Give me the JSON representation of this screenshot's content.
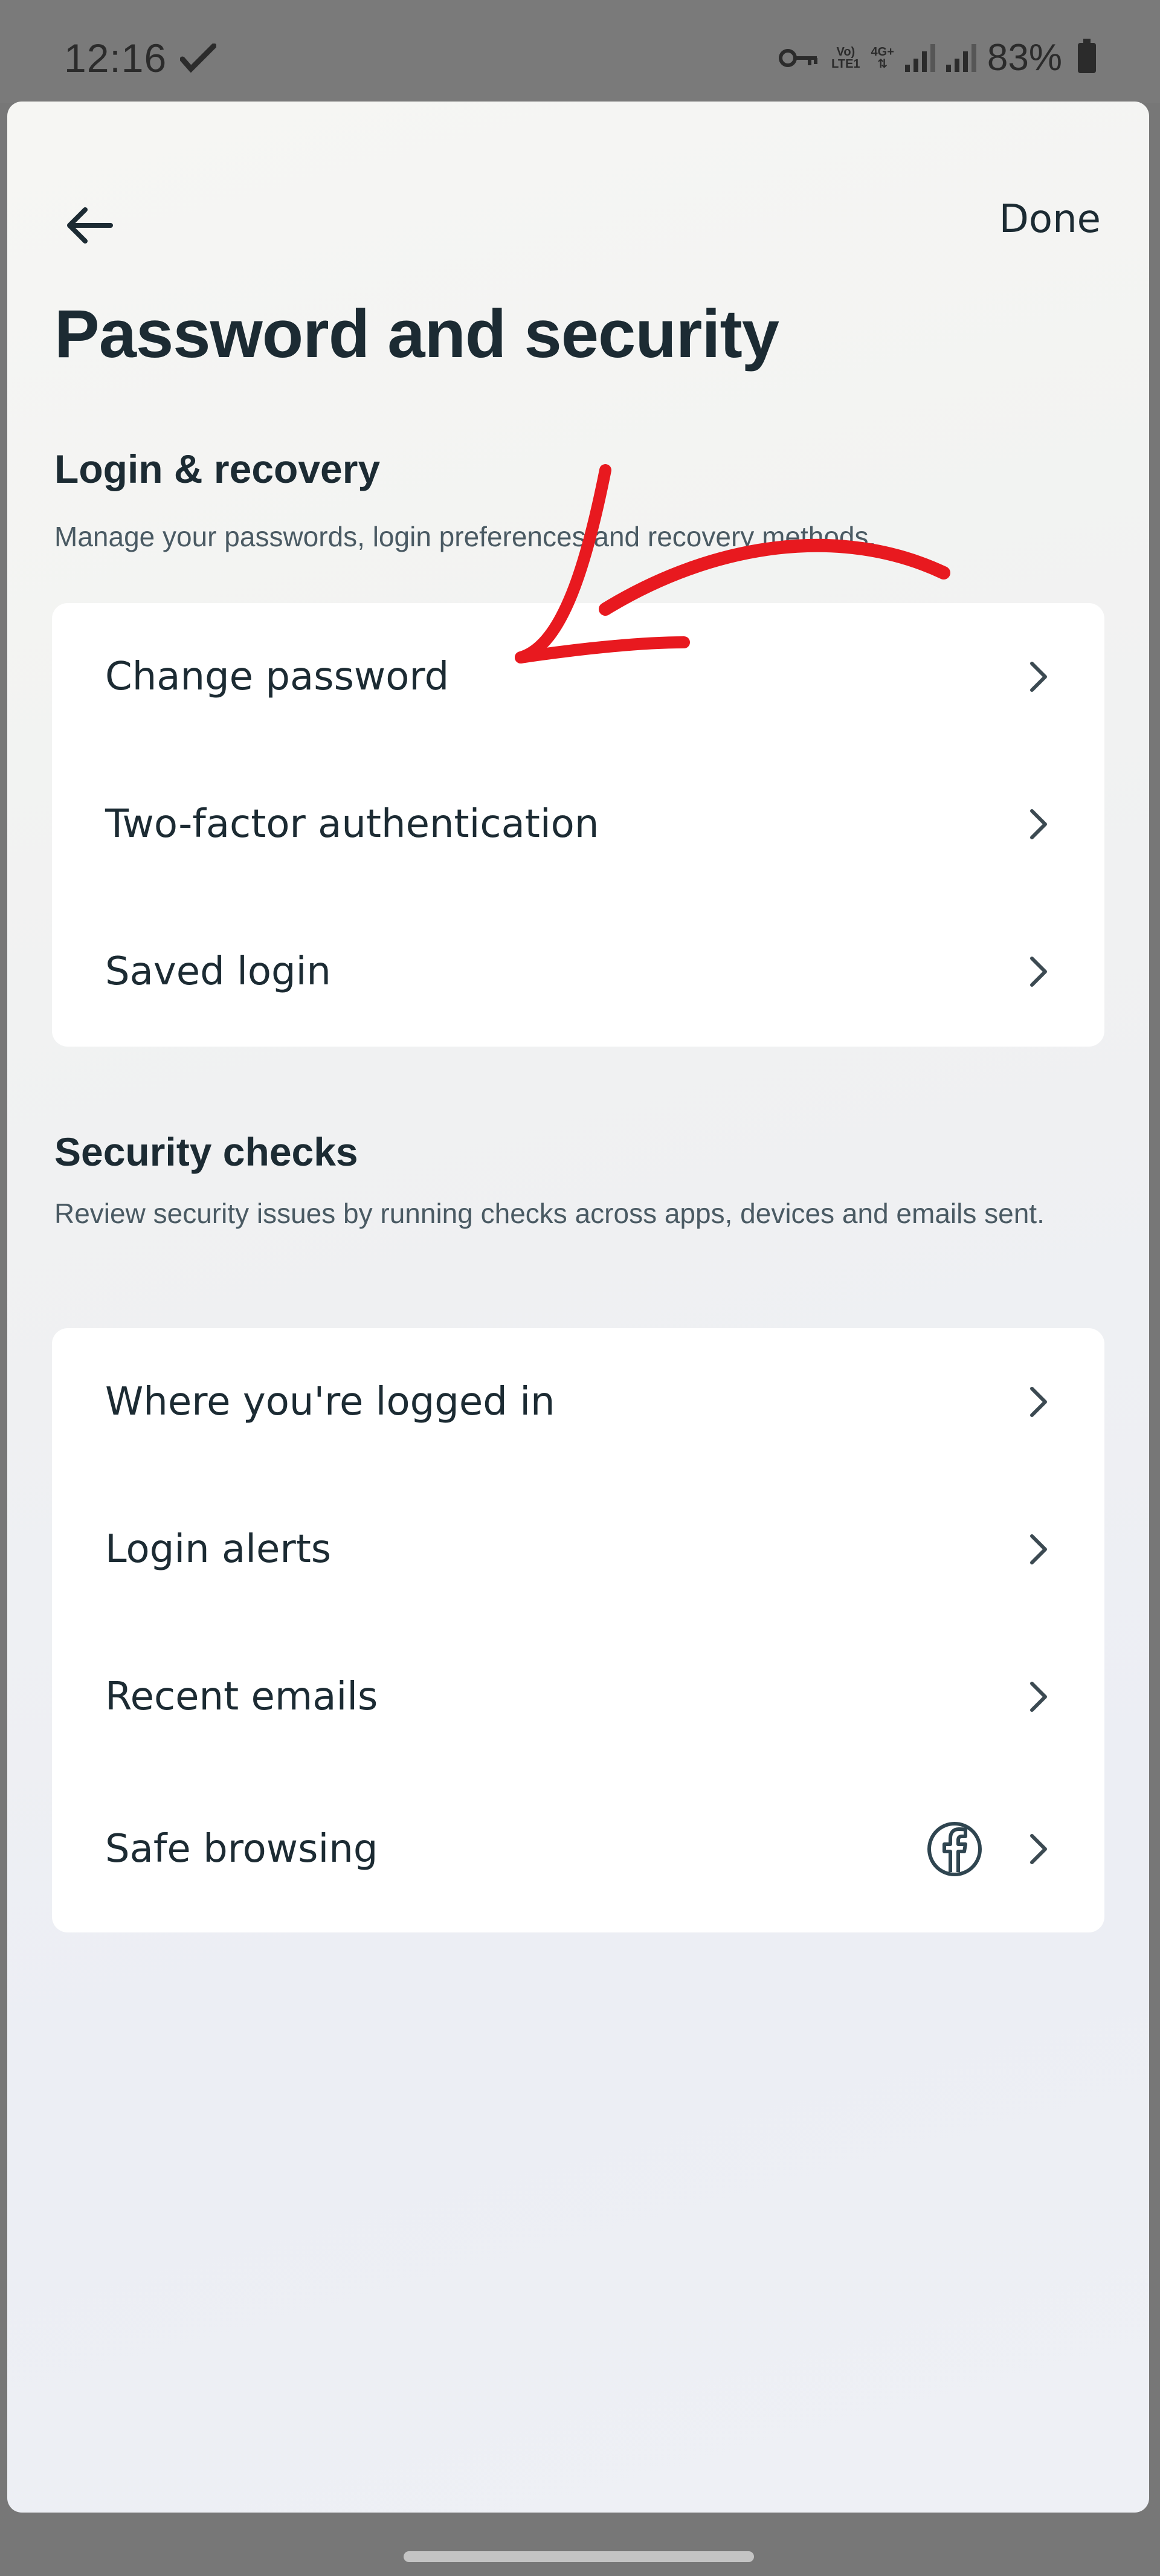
{
  "status_bar": {
    "time": "12:16",
    "network_top": "Vo)",
    "network_bottom": "LTE1",
    "network2_top": "4G+",
    "battery": "83%"
  },
  "header": {
    "done_label": "Done",
    "title": "Password and security"
  },
  "login_recovery": {
    "title": "Login & recovery",
    "description": "Manage your passwords, login preferences and recovery methods.",
    "items": [
      {
        "label": "Change password"
      },
      {
        "label": "Two-factor authentication"
      },
      {
        "label": "Saved login"
      }
    ]
  },
  "security_checks": {
    "title": "Security checks",
    "description": "Review security issues by running checks across apps, devices and emails sent.",
    "items": [
      {
        "label": "Where you're logged in"
      },
      {
        "label": "Login alerts"
      },
      {
        "label": "Recent emails"
      },
      {
        "label": "Safe browsing"
      }
    ]
  },
  "colors": {
    "text_primary": "#1c2b33",
    "text_secondary": "#4a5a63",
    "annotation_arrow": "#e8191f",
    "card_bg": "#ffffff"
  },
  "icons": {
    "back": "arrow-left-icon",
    "chevron": "chevron-right-icon",
    "facebook": "facebook-icon",
    "vpn_key": "key-icon"
  }
}
